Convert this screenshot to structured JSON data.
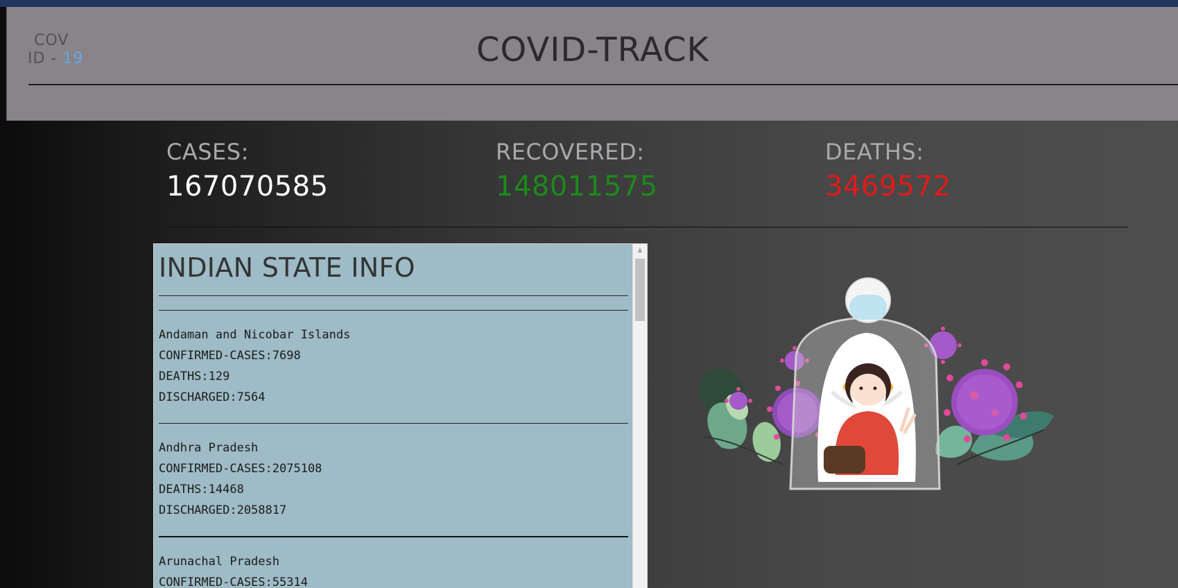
{
  "header": {
    "logo": {
      "line1": "COV",
      "line2_prefix": "ID - ",
      "line2_accent": "19"
    },
    "title": "COVID-TRACK"
  },
  "stats": {
    "cases": {
      "label": "CASES:",
      "value": "167070585",
      "color": "#ffffff"
    },
    "recovered": {
      "label": "RECOVERED:",
      "value": "148011575",
      "color": "#1c8a1c"
    },
    "deaths": {
      "label": "DEATHS:",
      "value": "3469572",
      "color": "#e01b1b"
    }
  },
  "panel": {
    "title": "INDIAN STATE INFO",
    "states": [
      {
        "name": "Andaman and Nicobar Islands",
        "confirmed": "CONFIRMED-CASES:7698",
        "deaths": "DEATHS:129",
        "discharged": "DISCHARGED:7564"
      },
      {
        "name": "Andhra Pradesh",
        "confirmed": "CONFIRMED-CASES:2075108",
        "deaths": "DEATHS:14468",
        "discharged": "DISCHARGED:2058817"
      },
      {
        "name": "Arunachal Pradesh",
        "confirmed": "CONFIRMED-CASES:55314"
      }
    ]
  },
  "illustration": {
    "icon": "covid-protection-illustration"
  },
  "colors": {
    "topbar": "#20365e",
    "header_bg": "#88848a",
    "panel_bg": "#9ebbc6",
    "logo_accent": "#6aa7da"
  }
}
